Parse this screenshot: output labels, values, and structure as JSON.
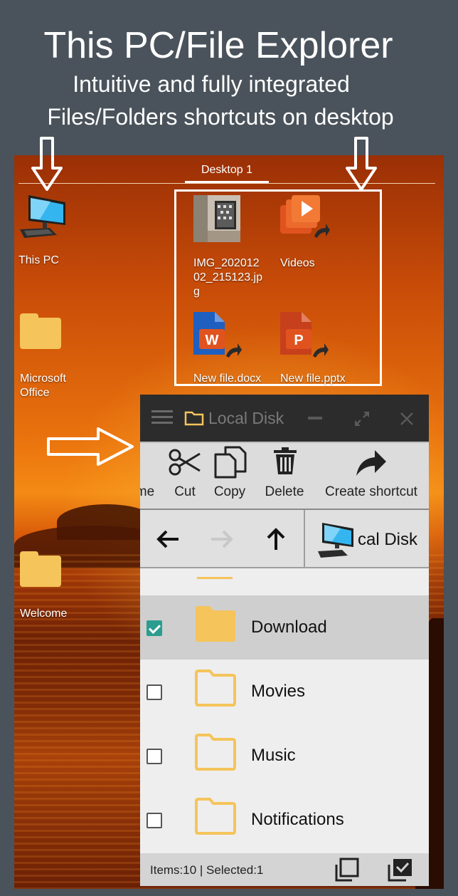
{
  "promo": {
    "title": "This PC/File Explorer",
    "line1": "Intuitive and fully integrated",
    "line2": "Files/Folders shortcuts on desktop"
  },
  "desktop": {
    "tab_label": "Desktop 1",
    "items": {
      "this_pc": {
        "label": "This PC",
        "icon": "computer-monitor-icon"
      },
      "ms_office": {
        "label": "Microsoft Office",
        "label_line1": "Microsoft",
        "label_line2": "Office",
        "icon": "folder-icon"
      },
      "welcome": {
        "label": "Welcome",
        "icon": "folder-icon"
      },
      "img": {
        "label_line1": "IMG_202012",
        "label_line2": "02_215123.jp",
        "label_line3": "g",
        "icon": "image-thumbnail-icon"
      },
      "videos": {
        "label": "Videos",
        "icon": "video-shortcut-icon"
      },
      "docx": {
        "label": "New file.docx",
        "icon": "word-doc-icon"
      },
      "pptx": {
        "label": "New file.pptx",
        "icon": "powerpoint-icon"
      }
    }
  },
  "file_manager": {
    "title": "Local Disk",
    "toolbar": {
      "rename_partial": "me",
      "cut": "Cut",
      "copy": "Copy",
      "delete": "Delete",
      "create_shortcut": "Create shortcut"
    },
    "nav": {
      "location_partial": "cal Disk"
    },
    "rows": [
      {
        "name": "Download",
        "checked": true
      },
      {
        "name": "Movies",
        "checked": false
      },
      {
        "name": "Music",
        "checked": false
      },
      {
        "name": "Notifications",
        "checked": false
      }
    ],
    "status": "Items:10 | Selected:1"
  },
  "colors": {
    "folder": "#f5c45b",
    "checkbox_checked": "#2a9d8f",
    "titlebar": "#2c2c2c",
    "page_bg": "#4a535b"
  }
}
